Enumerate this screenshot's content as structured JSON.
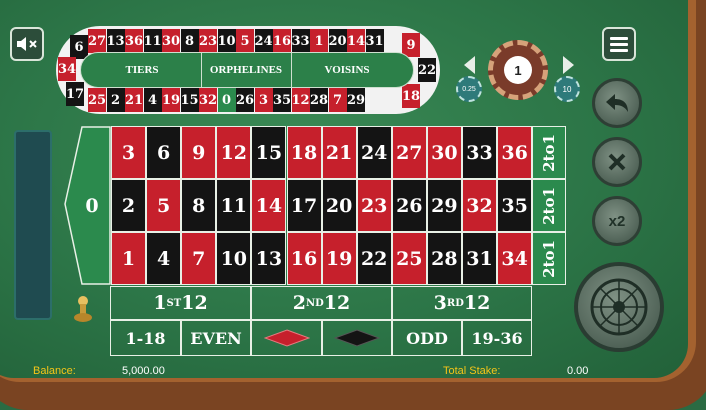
{
  "racetrack": {
    "top_numbers": [
      "6",
      "27",
      "13",
      "36",
      "11",
      "30",
      "8",
      "23",
      "10",
      "5",
      "24",
      "16",
      "33",
      "1",
      "20",
      "14",
      "31",
      "9"
    ],
    "bottom_numbers": [
      "25",
      "2",
      "21",
      "4",
      "19",
      "15",
      "32",
      "0",
      "26",
      "3",
      "35",
      "12",
      "28",
      "7",
      "29",
      "18"
    ],
    "left_numbers": [
      "34",
      "17"
    ],
    "right_numbers": [
      "22"
    ],
    "sections": [
      "TIERS",
      "ORPHELINES",
      "VOISINS"
    ]
  },
  "chip_selector": {
    "selected_value": "1",
    "left_chip": "0.25",
    "right_chip": "10"
  },
  "board": {
    "zero": "0",
    "rows": [
      [
        "3",
        "6",
        "9",
        "12",
        "15",
        "18",
        "21",
        "24",
        "27",
        "30",
        "33",
        "36"
      ],
      [
        "2",
        "5",
        "8",
        "11",
        "14",
        "17",
        "20",
        "23",
        "26",
        "29",
        "32",
        "35"
      ],
      [
        "1",
        "4",
        "7",
        "10",
        "13",
        "16",
        "19",
        "22",
        "25",
        "28",
        "31",
        "34"
      ]
    ],
    "row_colors": [
      [
        "red",
        "black",
        "red",
        "red",
        "black",
        "red",
        "red",
        "black",
        "red",
        "red",
        "black",
        "red"
      ],
      [
        "black",
        "red",
        "black",
        "black",
        "red",
        "black",
        "black",
        "red",
        "black",
        "black",
        "red",
        "black"
      ],
      [
        "red",
        "black",
        "red",
        "black",
        "black",
        "red",
        "red",
        "black",
        "red",
        "black",
        "black",
        "red"
      ]
    ],
    "columns": [
      "2to1",
      "2to1",
      "2to1"
    ],
    "dozens": [
      {
        "num": "1",
        "sup": "ST",
        "suffix": "12"
      },
      {
        "num": "2",
        "sup": "ND",
        "suffix": "12"
      },
      {
        "num": "3",
        "sup": "RD",
        "suffix": "12"
      }
    ],
    "outside": [
      "1-18",
      "EVEN",
      "",
      "",
      "ODD",
      "19-36"
    ]
  },
  "actions": {
    "double_label": "x2"
  },
  "footer": {
    "balance_label": "Balance:",
    "balance_value": "5,000.00",
    "total_stake_label": "Total Stake:",
    "total_stake_value": "0.00"
  },
  "colors": {
    "red": "#c6202c",
    "black": "#141414",
    "felt": "#2c7547",
    "label_yellow": "#f5c518"
  },
  "icons": [
    "speaker-muted-icon",
    "menu-icon",
    "undo-icon",
    "clear-icon",
    "double-icon",
    "spin-wheel-icon",
    "chevron-left-icon",
    "chevron-right-icon"
  ]
}
